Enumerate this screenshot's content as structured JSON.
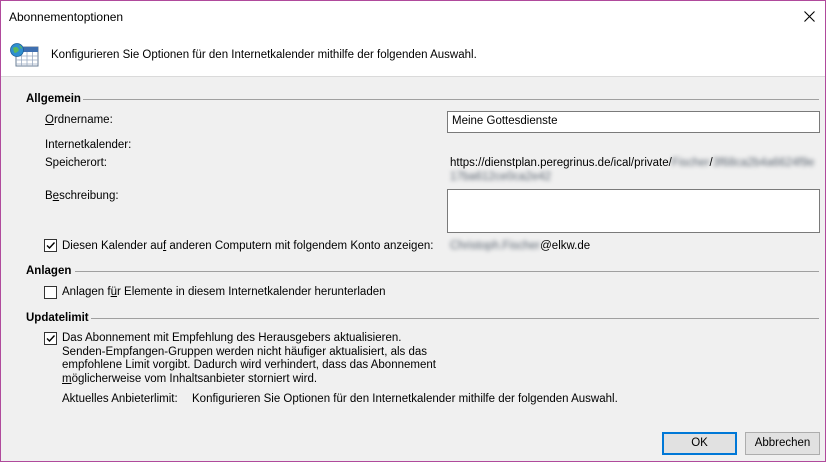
{
  "window": {
    "title": "Abonnementoptionen"
  },
  "banner": {
    "text": "Konfigurieren Sie Optionen für den Internetkalender mithilfe der folgenden Auswahl."
  },
  "general": {
    "heading": "Allgemein",
    "folder_label_u": "O",
    "folder_label_rest": "rdnername:",
    "folder_value": "Meine Gottesdienste",
    "calendar_label": "Internetkalender:",
    "location_label": "Speicherort:",
    "location_prefix": "https://dienstplan.peregrinus.de/ical/private/",
    "location_blur1": "Fischer",
    "location_slash": "/",
    "location_blur2": "3f68ca2b4a6624f9e",
    "location_blur3": "17ba612ce0ca2e42",
    "description_label_pre": "B",
    "description_label_u": "e",
    "description_label_rest": "schreibung:",
    "description_value": "",
    "sync_checkbox_pre": "Diesen Kalender au",
    "sync_checkbox_u": "f",
    "sync_checkbox_rest": " anderen Computern mit folgendem Konto anzeigen:",
    "sync_checked": true,
    "account_blur": "Christoph.Fischer",
    "account_domain": "@elkw.de"
  },
  "attachments": {
    "heading": "Anlagen",
    "checkbox_pre": "Anlagen f",
    "checkbox_u": "ü",
    "checkbox_rest": "r Elemente in diesem Internetkalender herunterladen",
    "checked": false
  },
  "update_limit": {
    "heading": "Updatelimit",
    "checked": true,
    "line1": "Das Abonnement mit Empfehlung des Herausgebers aktualisieren.",
    "line2": "Senden-Empfangen-Gruppen werden nicht häufiger aktualisiert, als das",
    "line3": "empfohlene Limit vorgibt. Dadurch wird verhindert, dass das Abonnement",
    "line4_u": "m",
    "line4_rest": "öglicherweise vom Inhaltsanbieter storniert wird.",
    "provider_label": "Aktuelles Anbieterlimit:",
    "provider_value": "Konfigurieren Sie Optionen für den Internetkalender mithilfe der folgenden Auswahl."
  },
  "buttons": {
    "ok": "OK",
    "cancel": "Abbrechen"
  }
}
